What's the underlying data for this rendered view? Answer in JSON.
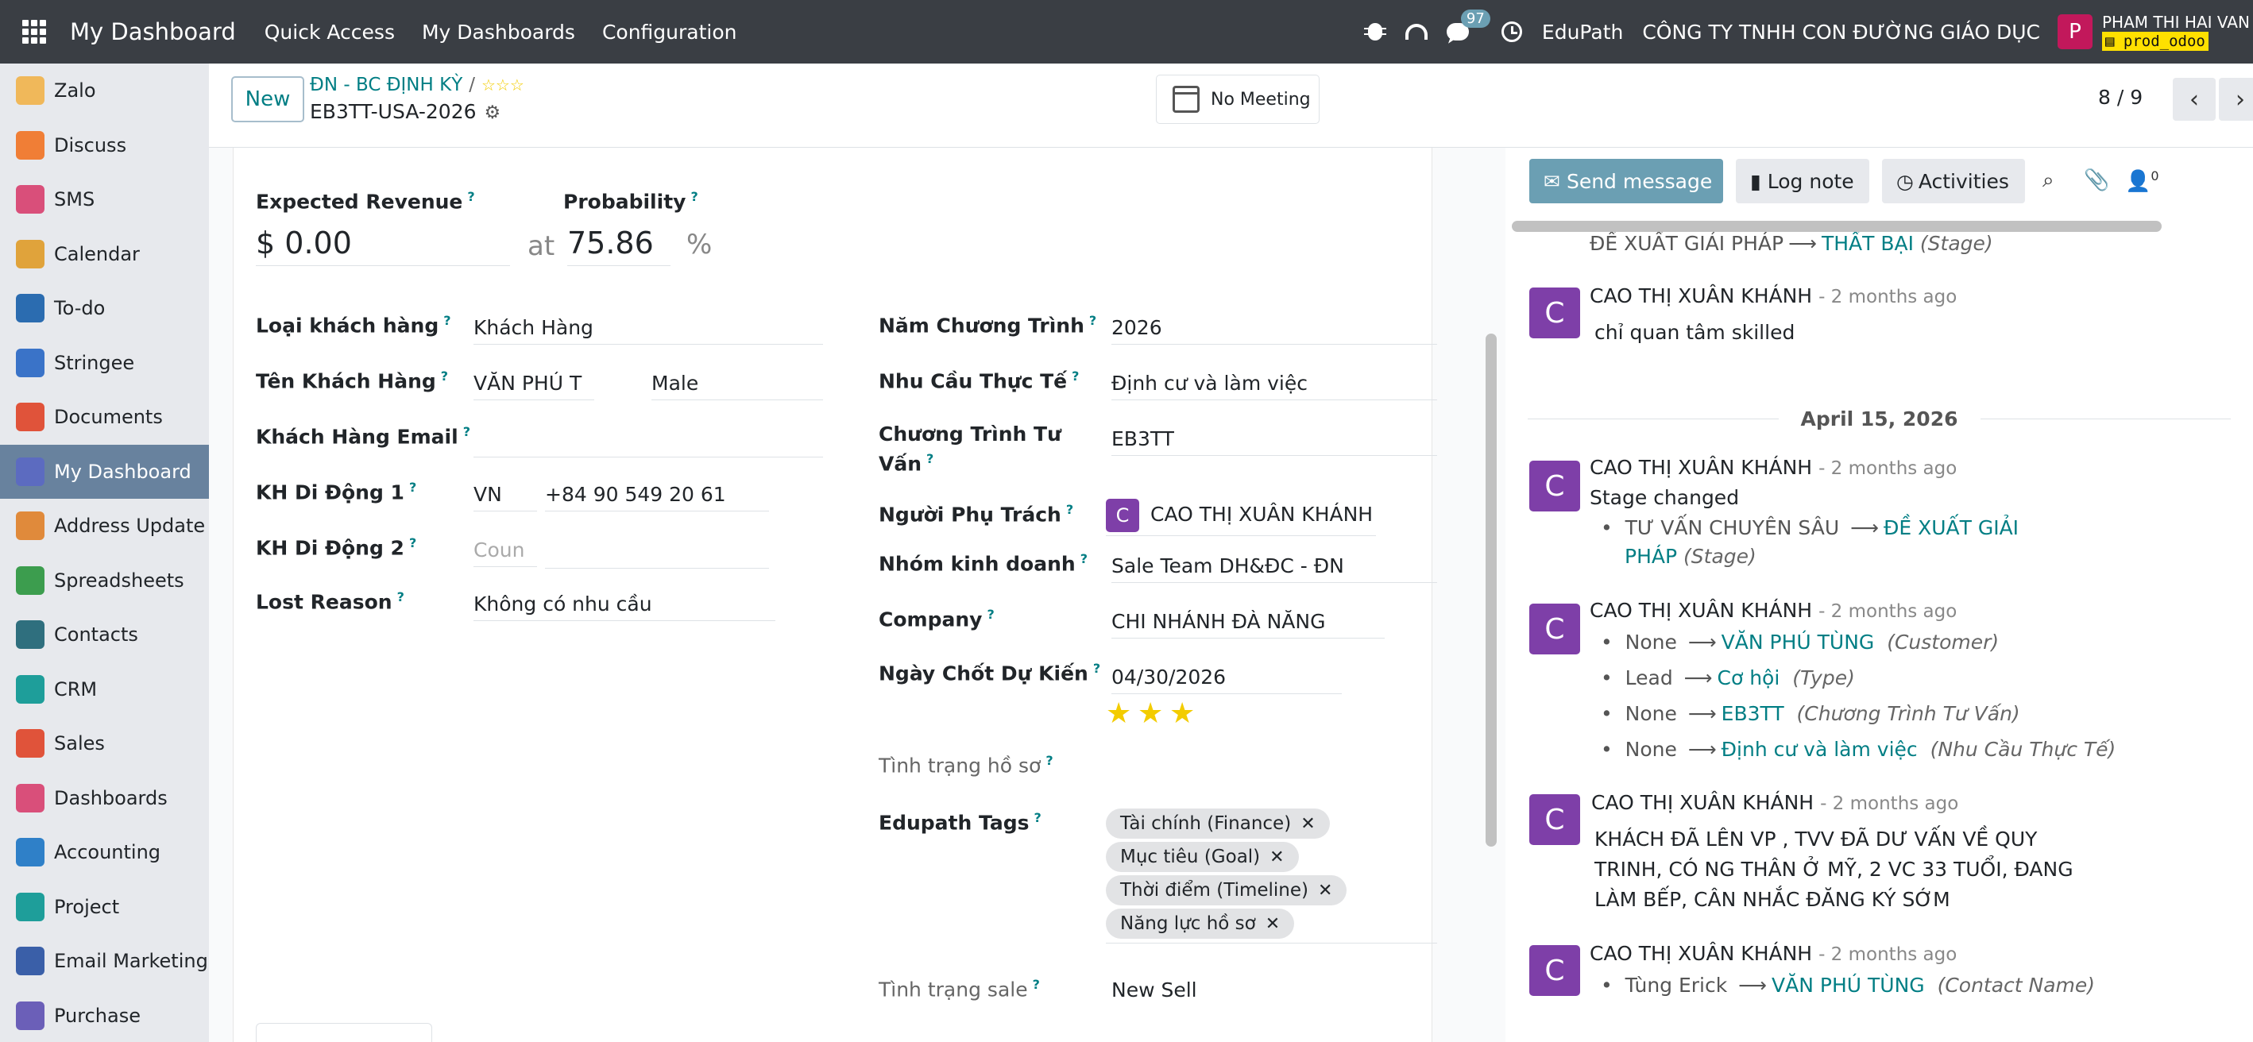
{
  "navbar": {
    "brand": "My Dashboard",
    "menus": [
      "Quick Access",
      "My Dashboards",
      "Configuration"
    ],
    "chat_badge": "97",
    "company_short": "EduPath",
    "company_full": "CÔNG TY TNHH CON ĐƯỜNG GIÁO DỤC",
    "user_initial": "P",
    "user_name": "PHAM THI HAI VAN",
    "db_name": "prod_odoo"
  },
  "sidebar": {
    "items": [
      {
        "label": "Zalo",
        "icon": "zalo-icon",
        "color": "#f0b85a"
      },
      {
        "label": "Discuss",
        "icon": "discuss-icon",
        "color": "#f07e36"
      },
      {
        "label": "SMS",
        "icon": "sms-icon",
        "color": "#d94f7a"
      },
      {
        "label": "Calendar",
        "icon": "calendar-icon",
        "color": "#e0a33b"
      },
      {
        "label": "To-do",
        "icon": "todo-icon",
        "color": "#2b6cb0"
      },
      {
        "label": "Stringee",
        "icon": "stringee-icon",
        "color": "#3a73c8"
      },
      {
        "label": "Documents",
        "icon": "documents-icon",
        "color": "#e0533a"
      },
      {
        "label": "My Dashboard",
        "icon": "dashboard-icon",
        "color": "#5c6bc0"
      },
      {
        "label": "Address Update",
        "icon": "address-update-icon",
        "color": "#e08a3b"
      },
      {
        "label": "Spreadsheets",
        "icon": "spreadsheets-icon",
        "color": "#3c9d4e"
      },
      {
        "label": "Contacts",
        "icon": "contacts-icon",
        "color": "#2f6f7e"
      },
      {
        "label": "CRM",
        "icon": "crm-icon",
        "color": "#1e9e9a"
      },
      {
        "label": "Sales",
        "icon": "sales-icon",
        "color": "#e0533a"
      },
      {
        "label": "Dashboards",
        "icon": "dashboards-icon",
        "color": "#d94f7a"
      },
      {
        "label": "Accounting",
        "icon": "accounting-icon",
        "color": "#2f80c8"
      },
      {
        "label": "Project",
        "icon": "project-icon",
        "color": "#1e9e9a"
      },
      {
        "label": "Email Marketing",
        "icon": "email-marketing-icon",
        "color": "#3a5fa8"
      },
      {
        "label": "Purchase",
        "icon": "purchase-icon",
        "color": "#6b5fb8"
      }
    ],
    "active_index": 7
  },
  "control": {
    "new_label": "New",
    "breadcrumb_parent": "ĐN - BC ĐỊNH KỲ",
    "breadcrumb_sep": "/",
    "breadcrumb_stars": "☆☆☆",
    "record_title": "EB3TT-USA-2026",
    "meeting_label": "No Meeting",
    "pager": "8 / 9"
  },
  "form": {
    "expected_revenue_label": "Expected Revenue",
    "currency": "$",
    "expected_revenue": "0.00",
    "at": "at",
    "probability_label": "Probability",
    "probability": "75.86",
    "percent": "%",
    "q": "?",
    "left": [
      {
        "label": "Loại khách hàng",
        "value": "Khách Hàng"
      },
      {
        "label": "Tên Khách Hàng",
        "value": "VĂN PHÚ T",
        "value2": "Male"
      },
      {
        "label": "Khách Hàng Email",
        "value": ""
      },
      {
        "label": "KH Di Động 1",
        "value": "VN",
        "value2": "+84 90 549 20 61"
      },
      {
        "label": "KH Di Động 2",
        "placeholder": "Coun"
      },
      {
        "label": "Lost Reason",
        "value": "Không có nhu cầu"
      }
    ],
    "right": [
      {
        "label": "Năm Chương Trình",
        "value": "2026"
      },
      {
        "label": "Nhu Cầu Thực Tế",
        "value": "Định cư và làm việc"
      },
      {
        "label_line1": "Chương Trình Tư",
        "label_line2": "Vấn",
        "value": "EB3TT"
      },
      {
        "label": "Người Phụ Trách",
        "avatar": "C",
        "value": "CAO THỊ XUÂN KHÁNH"
      },
      {
        "label": "Nhóm kinh doanh",
        "value": "Sale Team DH&ĐC - ĐN"
      },
      {
        "label": "Company",
        "value": "CHI NHÁNH ĐÀ NẴNG"
      },
      {
        "label": "Ngày Chốt Dự Kiến",
        "value": "04/30/2026"
      },
      {
        "label": "Tình trạng hồ sơ",
        "value": ""
      },
      {
        "label": "Edupath Tags",
        "value": ""
      },
      {
        "label": "Tình trạng sale",
        "value": "New Sell"
      }
    ],
    "priority_stars": 3,
    "tags": [
      "Tài chính (Finance)",
      "Mục tiêu (Goal)",
      "Thời điểm (Timeline)",
      "Năng lực hồ sơ"
    ]
  },
  "chatter": {
    "send_message": "Send message",
    "log_note": "Log note",
    "activities": "Activities",
    "followers_count": "0",
    "partial_top": {
      "old": "ĐỀ XUẤT GIẢI PHÁP",
      "new": "THẤT BẠI",
      "field": "(Stage)"
    },
    "date_separator": "April 15, 2026",
    "messages": [
      {
        "initial": "C",
        "author": "CAO THỊ XUÂN KHÁNH",
        "date": "- 2 months ago",
        "body": "chỉ quan tâm skilled"
      },
      {
        "initial": "C",
        "author": "CAO THỊ XUÂN KHÁNH",
        "date": "- 2 months ago",
        "body": "Stage changed",
        "track_old": "TƯ VẤN CHUYÊN SÂU",
        "track_new_1": "ĐỀ XUẤT GIẢI",
        "track_new_2": "PHÁP",
        "track_field": "(Stage)"
      },
      {
        "initial": "C",
        "author": "CAO THỊ XUÂN KHÁNH",
        "date": "- 2 months ago",
        "tracks": [
          {
            "old": "None",
            "new": "VĂN PHÚ TÙNG",
            "field": "(Customer)"
          },
          {
            "old": "Lead",
            "new": "Cơ hội",
            "field": "(Type)"
          },
          {
            "old": "None",
            "new": "EB3TT",
            "field": "(Chương Trình Tư Vấn)"
          },
          {
            "old": "None",
            "new": "Định cư và làm việc",
            "field": "(Nhu Cầu Thực Tế)"
          }
        ]
      },
      {
        "initial": "C",
        "author": "CAO THỊ XUÂN KHÁNH",
        "date": "- 2 months ago",
        "lines": [
          "KHÁCH ĐÃ LÊN VP , TVV ĐÃ DƯ VẤN VỀ QUY",
          "TRINH, CÓ NG THÂN Ở MỸ, 2 VC 33 TUỔI, ĐANG",
          "LÀM BẾP, CÂN NHẮC ĐĂNG KÝ SỚM"
        ]
      },
      {
        "initial": "C",
        "author": "CAO THỊ XUÂN KHÁNH",
        "date": "- 2 months ago",
        "tracks": [
          {
            "old": "Tùng Erick",
            "new": "VĂN PHÚ TÙNG",
            "field": "(Contact Name)"
          }
        ]
      }
    ]
  }
}
